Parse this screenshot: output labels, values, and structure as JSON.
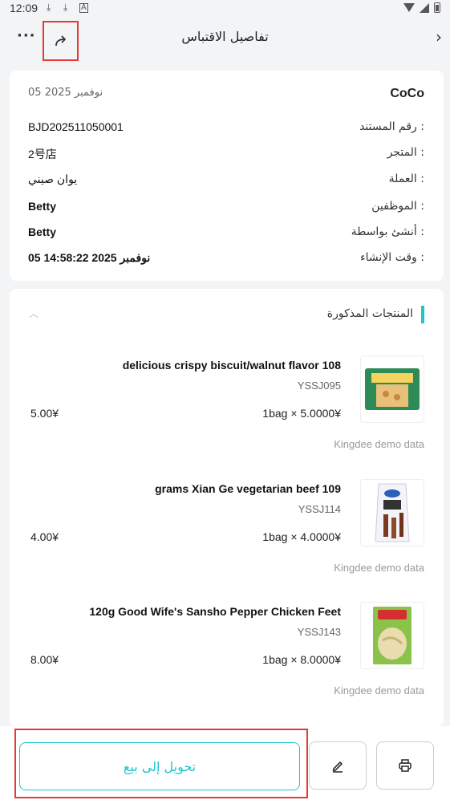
{
  "status_bar": {
    "time": "12:09"
  },
  "nav": {
    "title": "تفاصيل الاقتباس",
    "more": "···",
    "back": "›"
  },
  "info": {
    "date": "05 نوفمبر 2025",
    "company": "CoCo",
    "rows": [
      {
        "label": "رقم المستند :",
        "value": "BJD202511050001",
        "bold": false
      },
      {
        "label": "المتجر :",
        "value": "2号店",
        "bold": false
      },
      {
        "label": "العملة :",
        "value": "يوان صيني",
        "bold": false
      },
      {
        "label": "الموظفين :",
        "value": "Betty",
        "bold": true
      },
      {
        "label": "أنشئ بواسطة :",
        "value": "Betty",
        "bold": true
      },
      {
        "label": "وقت الإنشاء :",
        "value": "05 نوفمبر 2025  14:58:22",
        "bold": true
      }
    ]
  },
  "products": {
    "section_title": "المنتجات المذكورة",
    "items": [
      {
        "name": "delicious crispy biscuit/walnut flavor 108",
        "code": "YSSJ095",
        "qty": "1bag × 5.0000¥",
        "total": "5.00¥",
        "source": "Kingdee demo data",
        "image": "biscuit-package-image"
      },
      {
        "name": "grams Xian Ge vegetarian beef 109",
        "code": "YSSJ114",
        "qty": "1bag × 4.0000¥",
        "total": "4.00¥",
        "source": "Kingdee demo data",
        "image": "vegetarian-beef-package-image"
      },
      {
        "name": "120g Good Wife's Sansho Pepper Chicken Feet",
        "code": "YSSJ143",
        "qty": "1bag × 8.0000¥",
        "total": "8.00¥",
        "source": "Kingdee demo data",
        "image": "chicken-feet-package-image"
      }
    ]
  },
  "bottom": {
    "convert_label": "تحويل إلى بيع",
    "edit_icon": "edit-icon",
    "print_icon": "print-icon"
  },
  "colors": {
    "accent": "#20c4cf",
    "highlight": "#e53935"
  }
}
